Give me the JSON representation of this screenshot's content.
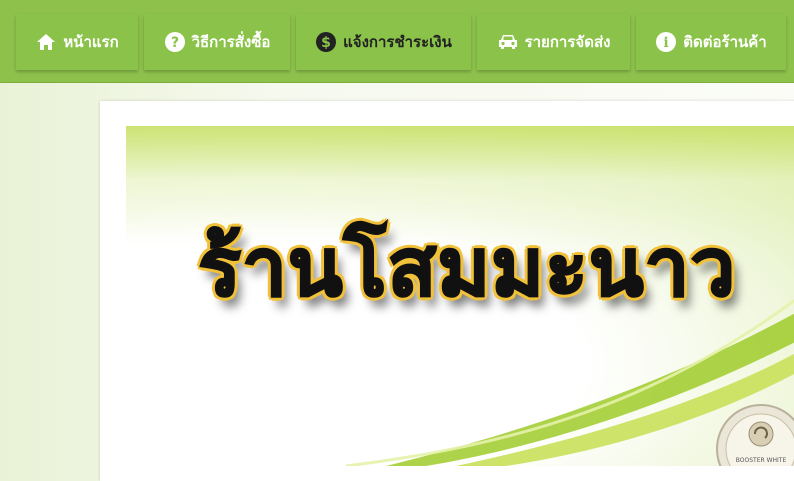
{
  "nav": {
    "items": [
      {
        "label": "หน้าแรก",
        "icon": "home-icon"
      },
      {
        "label": "วิธีการสั่งซื้อ",
        "icon": "question-circle-icon"
      },
      {
        "label": "แจ้งการชำระเงิน",
        "icon": "dollar-circle-icon"
      },
      {
        "label": "รายการจัดส่ง",
        "icon": "car-icon"
      },
      {
        "label": "ติดต่อร้านค้า",
        "icon": "info-circle-icon"
      }
    ]
  },
  "banner": {
    "title": "ร้านโสมมะนาว",
    "product_seal_text": "BOOSTER WHITE"
  },
  "colors": {
    "nav_bg": "#8dc14c",
    "nav_item_bg": "#8bc34a",
    "title_outline": "#f2c13a",
    "banner_green": "#cfe37a"
  }
}
